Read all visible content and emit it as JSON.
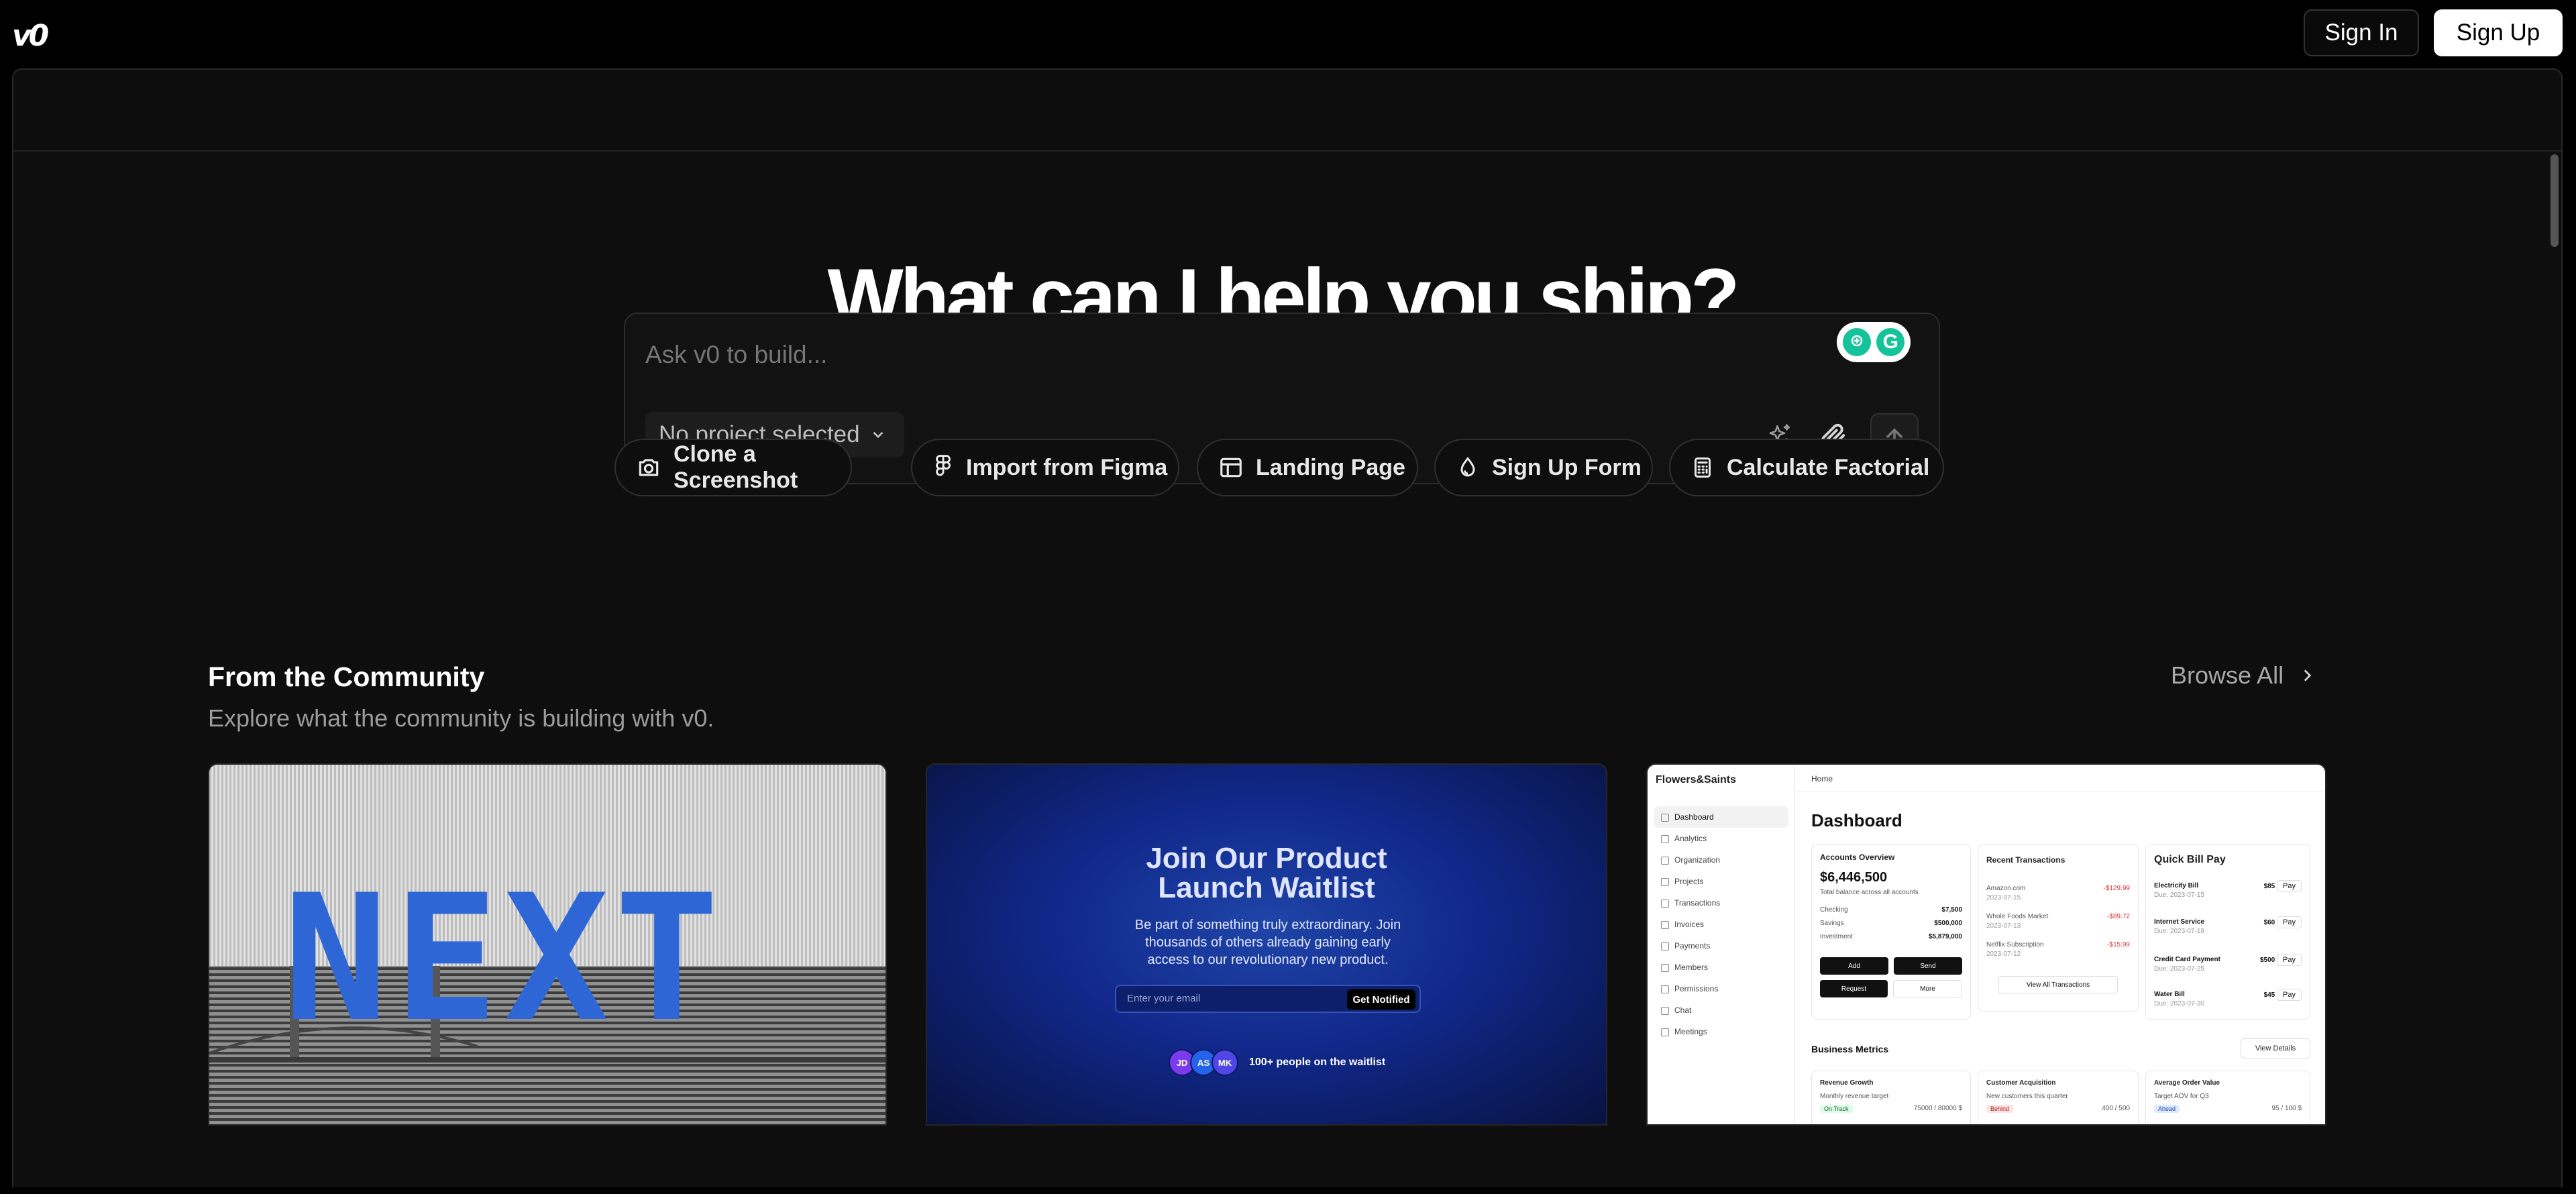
{
  "app": {
    "logo_text": "v0"
  },
  "header": {
    "sign_in": "Sign In",
    "sign_up": "Sign Up"
  },
  "hero": {
    "headline": "What can I help you ship?"
  },
  "prompt": {
    "placeholder": "Ask v0 to build...",
    "project_select": "No project selected",
    "grammarly_label": "G"
  },
  "suggestions": [
    {
      "label": "Clone a Screenshot",
      "icon": "camera-icon"
    },
    {
      "label": "Import from Figma",
      "icon": "figma-icon"
    },
    {
      "label": "Landing Page",
      "icon": "layout-icon"
    },
    {
      "label": "Sign Up Form",
      "icon": "droplet-icon"
    },
    {
      "label": "Calculate Factorial",
      "icon": "calculator-icon"
    }
  ],
  "community": {
    "title": "From the Community",
    "subtitle": "Explore what the community is building with v0.",
    "browse_all": "Browse All"
  },
  "cards": {
    "next": {
      "word": "NEXT"
    },
    "waitlist": {
      "title_line1": "Join Our Product",
      "title_line2": "Launch Waitlist",
      "description": "Be part of something truly extraordinary. Join thousands of others already gaining early access to our revolutionary new product.",
      "email_placeholder": "Enter your email",
      "button": "Get Notified",
      "avatars": [
        "JD",
        "AS",
        "MK"
      ],
      "waitlist_count": "100+ people on the waitlist"
    },
    "dashboard": {
      "brand": "Flowers&Saints",
      "breadcrumb": "Home",
      "title": "Dashboard",
      "nav": [
        "Dashboard",
        "Analytics",
        "Organization",
        "Projects",
        "Transactions",
        "Invoices",
        "Payments",
        "Members",
        "Permissions",
        "Chat",
        "Meetings"
      ],
      "accounts": {
        "title": "Accounts Overview",
        "total": "$6,446,500",
        "total_label": "Total balance across all accounts",
        "rows": [
          {
            "label": "Checking",
            "value": "$7,500"
          },
          {
            "label": "Savings",
            "value": "$500,000"
          },
          {
            "label": "Investment",
            "value": "$5,879,000"
          }
        ],
        "actions": [
          "Add",
          "Send",
          "Request",
          "More"
        ]
      },
      "transactions": {
        "title": "Recent Transactions",
        "rows": [
          {
            "name": "Amazon.com",
            "date": "2023-07-15",
            "amount": "-$129.99"
          },
          {
            "name": "Whole Foods Market",
            "date": "2023-07-13",
            "amount": "-$89.72"
          },
          {
            "name": "Netflix Subscription",
            "date": "2023-07-12",
            "amount": "-$15.99"
          }
        ],
        "view_all": "View All Transactions"
      },
      "bills": {
        "title": "Quick Bill Pay",
        "pay": "Pay",
        "rows": [
          {
            "name": "Electricity Bill",
            "due": "Due: 2023-07-15",
            "amount": "$85"
          },
          {
            "name": "Internet Service",
            "due": "Due: 2023-07-18",
            "amount": "$60"
          },
          {
            "name": "Credit Card Payment",
            "due": "Due: 2023-07-25",
            "amount": "$500"
          },
          {
            "name": "Water Bill",
            "due": "Due: 2023-07-30",
            "amount": "$45"
          }
        ]
      },
      "metrics": {
        "title": "Business Metrics",
        "view_details": "View Details",
        "items": [
          {
            "name": "Revenue Growth",
            "sub": "Monthly revenue target",
            "tag": "On Track",
            "value": "75000 / 80000 $"
          },
          {
            "name": "Customer Acquisition",
            "sub": "New customers this quarter",
            "tag": "Behind",
            "value": "400 / 500"
          },
          {
            "name": "Average Order Value",
            "sub": "Target AOV for Q3",
            "tag": "Ahead",
            "value": "95 / 100 $"
          }
        ]
      }
    }
  }
}
